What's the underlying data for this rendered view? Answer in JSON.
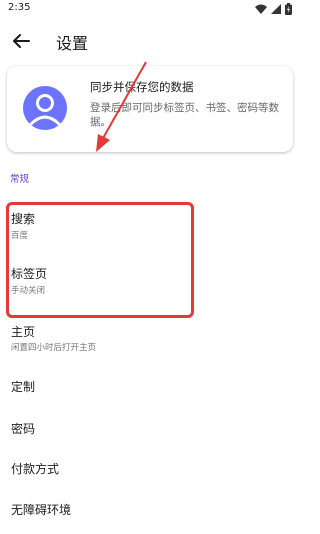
{
  "status": {
    "time": "2:35"
  },
  "appbar": {
    "title": "设置"
  },
  "account_card": {
    "title": "同步并保存您的数据",
    "description": "登录后即可同步标签页、书签、密码等数据。"
  },
  "section": {
    "label": "常规"
  },
  "items": [
    {
      "label": "搜索",
      "sub": "百度"
    },
    {
      "label": "标签页",
      "sub": "手动关闭"
    },
    {
      "label": "主页",
      "sub": "闲置四小时后打开主页"
    },
    {
      "label": "定制"
    },
    {
      "label": "密码"
    },
    {
      "label": "付款方式"
    },
    {
      "label": "无障碍环境"
    }
  ],
  "colors": {
    "accent": "#6a3fd6",
    "highlight": "#e53935",
    "avatar": "#6b73ff"
  }
}
